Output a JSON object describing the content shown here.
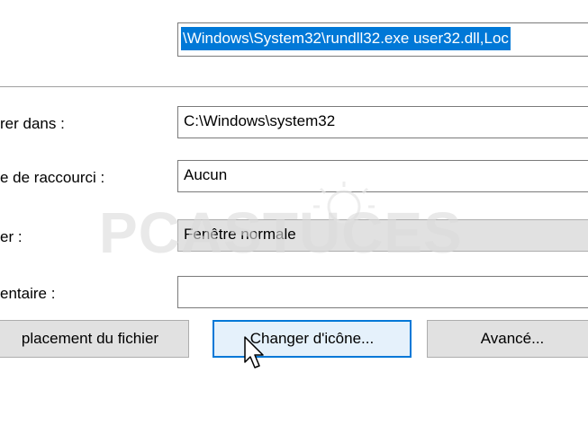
{
  "target": {
    "value": "\\Windows\\System32\\rundll32.exe user32.dll,Loc"
  },
  "fields": {
    "start_in": {
      "label": "rer dans :",
      "value": "C:\\Windows\\system32"
    },
    "shortcut_key": {
      "label": "e de raccourci :",
      "value": "Aucun"
    },
    "run": {
      "label": "er :",
      "value": "Fenêtre normale"
    },
    "comment": {
      "label": "entaire :",
      "value": ""
    }
  },
  "buttons": {
    "open_location": "placement du fichier",
    "change_icon": "Changer d'icône...",
    "advanced": "Avancé..."
  },
  "watermark": {
    "text": "PCASTUCES"
  }
}
